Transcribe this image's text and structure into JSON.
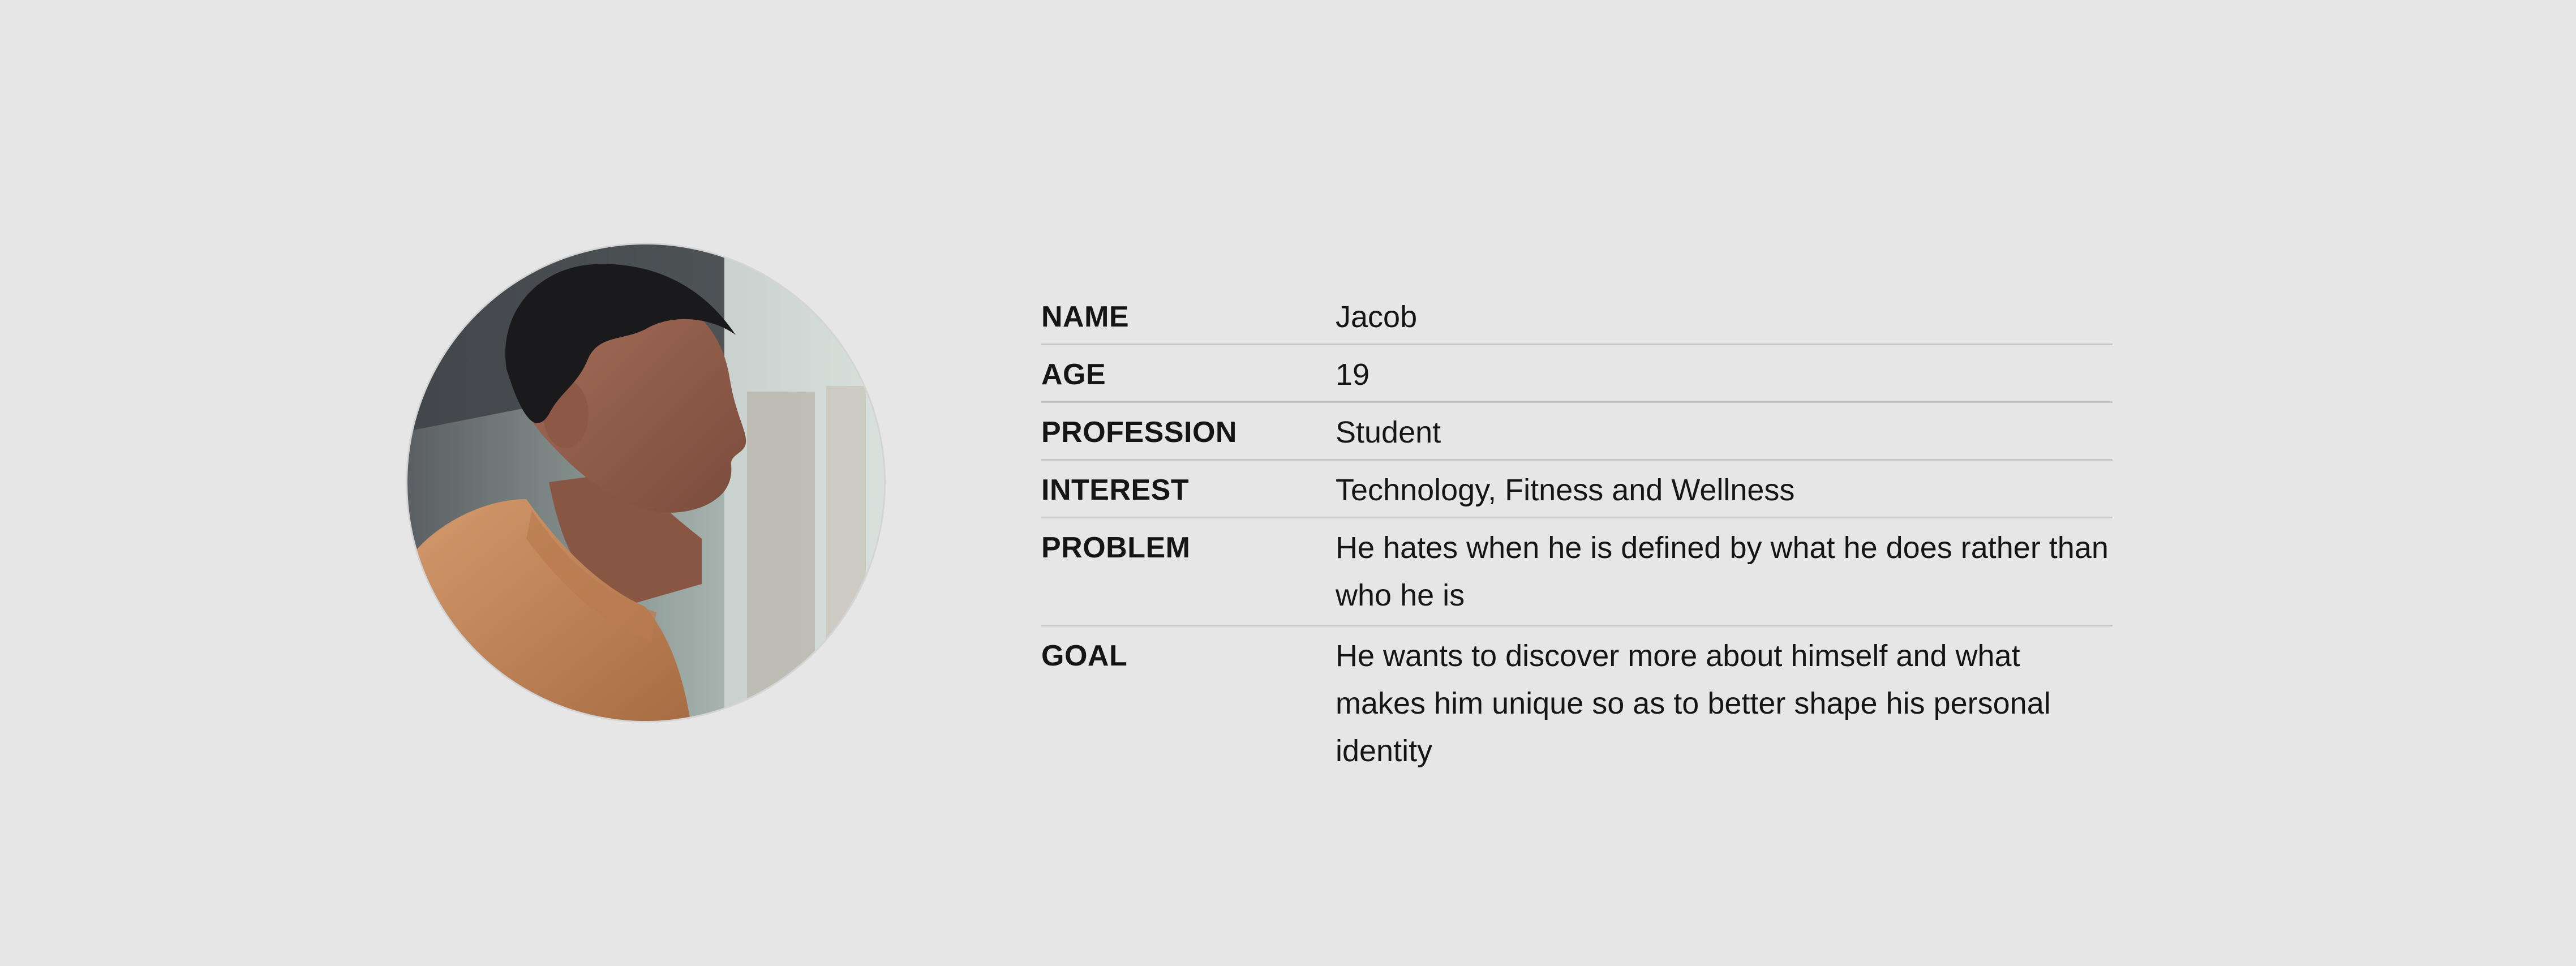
{
  "portrait": {
    "icon": "person-portrait-photo"
  },
  "profile": {
    "rows": [
      {
        "label": "NAME",
        "value": "Jacob"
      },
      {
        "label": "AGE",
        "value": "19"
      },
      {
        "label": "PROFESSION",
        "value": "Student"
      },
      {
        "label": "INTEREST",
        "value": "Technology, Fitness and Wellness"
      },
      {
        "label": "PROBLEM",
        "value": "He hates when he is defined by what he does rather than who he is"
      },
      {
        "label": "GOAL",
        "value": "He wants to discover more about himself and what makes him unique so as to better shape his personal identity"
      }
    ]
  },
  "colors": {
    "background": "#e6e6e6",
    "divider": "#c6c6c6",
    "text": "#151515",
    "sweater": "#c4875a"
  }
}
